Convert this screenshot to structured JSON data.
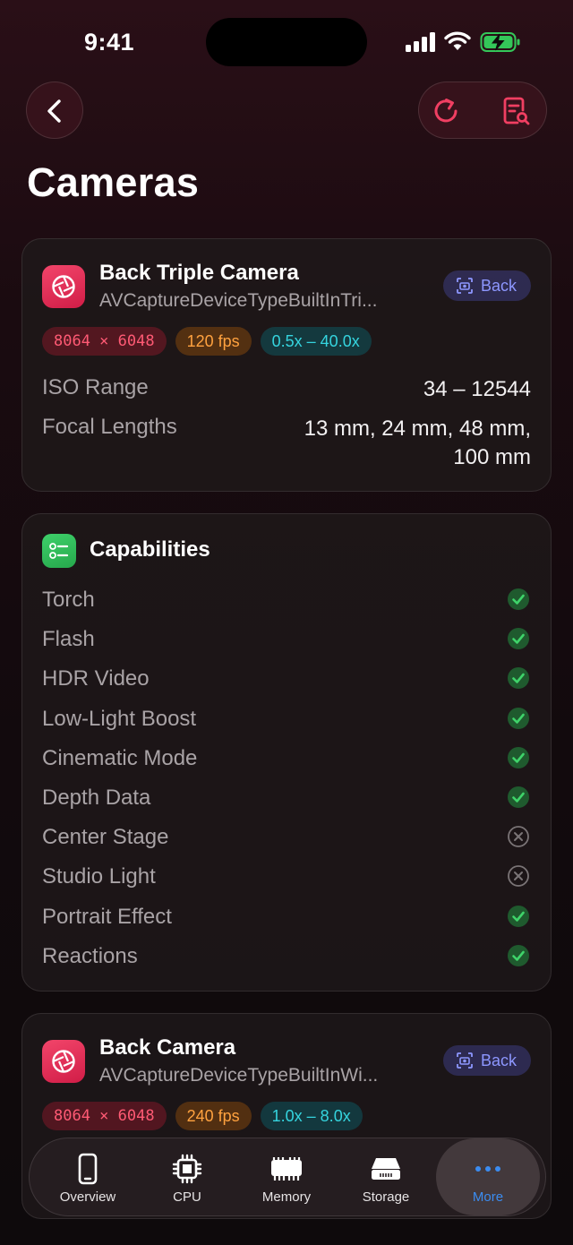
{
  "status": {
    "time": "9:41"
  },
  "page": {
    "title": "Cameras"
  },
  "cameras": [
    {
      "name": "Back Triple Camera",
      "device_type": "AVCaptureDeviceTypeBuiltInTri...",
      "position": "Back",
      "resolution": "8064 × 6048",
      "fps": "120 fps",
      "zoom": "0.5x – 40.0x",
      "iso_label": "ISO Range",
      "iso_value": "34 – 12544",
      "focal_label": "Focal Lengths",
      "focal_value_line1": "13 mm, 24 mm, 48 mm,",
      "focal_value_line2": "100 mm"
    },
    {
      "name": "Back Camera",
      "device_type": "AVCaptureDeviceTypeBuiltInWi...",
      "position": "Back",
      "resolution": "8064 × 6048",
      "fps": "240 fps",
      "zoom": "1.0x – 8.0x"
    }
  ],
  "capabilities": {
    "title": "Capabilities",
    "items": [
      {
        "label": "Torch",
        "supported": true
      },
      {
        "label": "Flash",
        "supported": true
      },
      {
        "label": "HDR Video",
        "supported": true
      },
      {
        "label": "Low-Light Boost",
        "supported": true
      },
      {
        "label": "Cinematic Mode",
        "supported": true
      },
      {
        "label": "Depth Data",
        "supported": true
      },
      {
        "label": "Center Stage",
        "supported": false
      },
      {
        "label": "Studio Light",
        "supported": false
      },
      {
        "label": "Portrait Effect",
        "supported": true
      },
      {
        "label": "Reactions",
        "supported": true
      }
    ]
  },
  "tabs": [
    {
      "label": "Overview",
      "icon": "phone-icon",
      "active": false
    },
    {
      "label": "CPU",
      "icon": "chip-icon",
      "active": false
    },
    {
      "label": "Memory",
      "icon": "memory-icon",
      "active": false
    },
    {
      "label": "Storage",
      "icon": "storage-icon",
      "active": false
    },
    {
      "label": "More",
      "icon": "more-icon",
      "active": true
    }
  ],
  "colors": {
    "accent_red": "#e8365b",
    "accent_green": "#34c759",
    "accent_blue": "#3b8cf0",
    "position_badge": "#8d97ff"
  }
}
